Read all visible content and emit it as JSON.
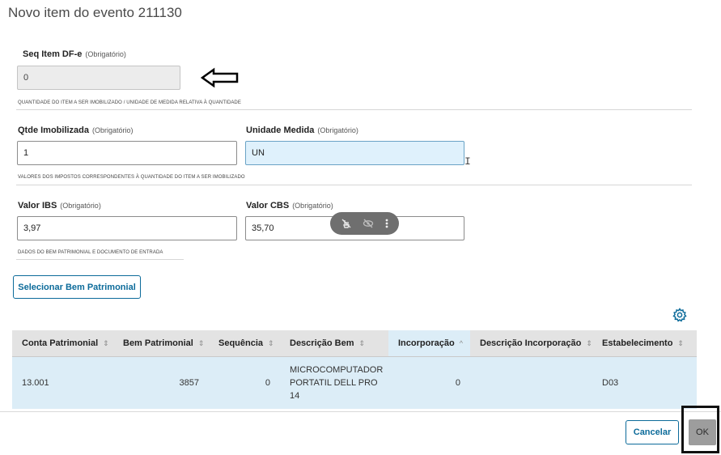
{
  "dialog": {
    "title": "Novo item do evento 211130"
  },
  "fields": {
    "seq_item": {
      "label": "Seq Item DF-e",
      "required": "(Obrigatório)",
      "value": "0"
    },
    "qtde": {
      "label": "Qtde Imobilizada",
      "required": "(Obrigatório)",
      "value": "1"
    },
    "unidade": {
      "label": "Unidade Medida",
      "required": "(Obrigatório)",
      "value": "UN"
    },
    "ibs": {
      "label": "Valor IBS",
      "required": "(Obrigatório)",
      "value": "3,97"
    },
    "cbs": {
      "label": "Valor CBS",
      "required": "(Obrigatório)",
      "value": "35,70"
    }
  },
  "sections": {
    "quantidade": "QUANTIDADE DO ITEM A SER IMOBILIZADO / UNIDADE DE MEDIDA RELATIVA À QUANTIDADE",
    "valores": "VALORES DOS IMPOSTOS CORRESPONDENTES À QUANTIDADE DO ITEM A SER IMOBILIZADO",
    "dados": "DADOS DO BEM PATRIMONIAL E DOCUMENTO DE ENTRADA"
  },
  "actions": {
    "selecionar": "Selecionar Bem Patrimonial",
    "cancelar": "Cancelar",
    "ok": "OK"
  },
  "table": {
    "columns": [
      {
        "label": "Conta Patrimonial",
        "sort": "⇕"
      },
      {
        "label": "Bem Patrimonial",
        "sort": "⇕"
      },
      {
        "label": "Sequência",
        "sort": "⇕"
      },
      {
        "label": "Descrição Bem",
        "sort": "⇕"
      },
      {
        "label": "Incorporação",
        "sort": "^"
      },
      {
        "label": "Descrição Incorporação",
        "sort": "⇕"
      },
      {
        "label": "Estabelecimento",
        "sort": "⇕"
      }
    ],
    "rows": [
      {
        "conta": "13.001",
        "bem": "3857",
        "sequencia": "0",
        "descricao": "MICROCOMPUTADOR PORTATIL DELL PRO 14",
        "incorporacao": "0",
        "descricao_incorporacao": "",
        "estabelecimento": "D03"
      }
    ]
  },
  "icons": {
    "arrow": "left-arrow-icon",
    "gear": "gear-icon",
    "overlay": [
      "no-touch-icon",
      "hide-icon",
      "more-vertical-icon"
    ]
  },
  "colors": {
    "primary": "#0c6b9a",
    "focus_bg": "#dff1fc",
    "row_highlight": "#dcedf7"
  }
}
